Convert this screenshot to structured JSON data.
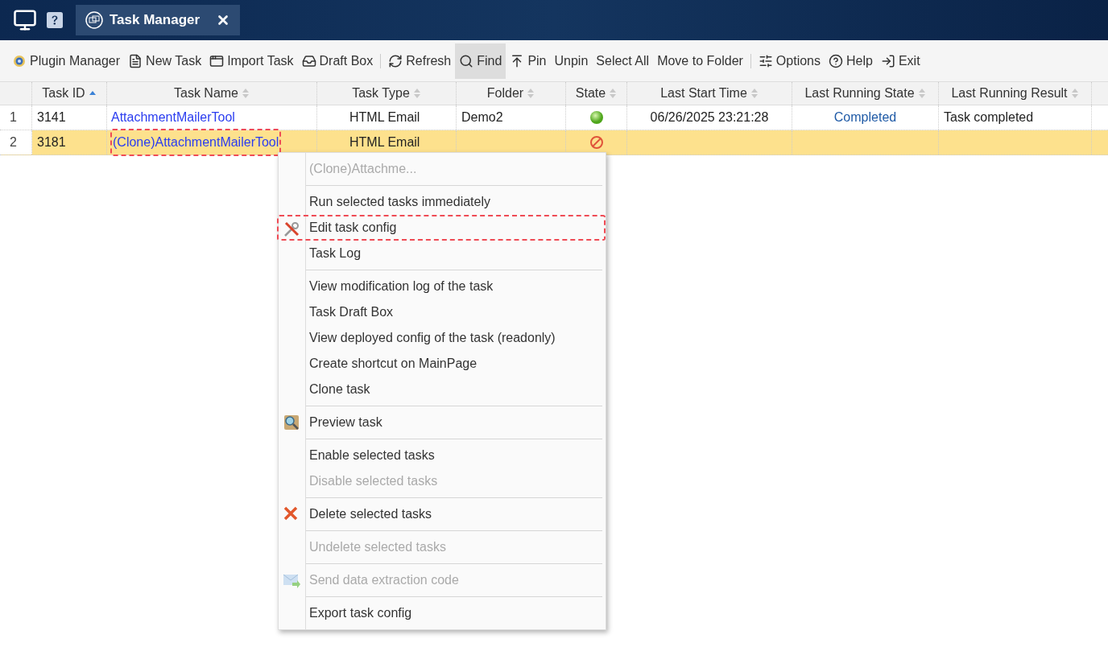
{
  "tab": {
    "title": "Task Manager",
    "selected": true
  },
  "toolbar": [
    {
      "label": "Plugin Manager",
      "kind": "plugin",
      "active": false,
      "separator_after": false
    },
    {
      "label": "New Task",
      "kind": "new",
      "active": false,
      "separator_after": false
    },
    {
      "label": "Import Task",
      "kind": "import",
      "active": false,
      "separator_after": false
    },
    {
      "label": "Draft Box",
      "kind": "draft",
      "active": false,
      "separator_after": true
    },
    {
      "label": "Refresh",
      "kind": "refresh",
      "active": false,
      "separator_after": false
    },
    {
      "label": "Find",
      "kind": "find",
      "active": true,
      "separator_after": false
    },
    {
      "label": "Pin",
      "kind": "pin",
      "active": false,
      "separator_after": false
    },
    {
      "label": "Unpin",
      "kind": "text",
      "active": false,
      "separator_after": false
    },
    {
      "label": "Select All",
      "kind": "text",
      "active": false,
      "separator_after": false
    },
    {
      "label": "Move to Folder",
      "kind": "text",
      "active": false,
      "separator_after": true
    },
    {
      "label": "Options",
      "kind": "options",
      "active": false,
      "separator_after": false
    },
    {
      "label": "Help",
      "kind": "help",
      "active": false,
      "separator_after": false
    },
    {
      "label": "Exit",
      "kind": "exit",
      "active": false,
      "separator_after": false
    }
  ],
  "table": {
    "columns": [
      {
        "label": "Task ID",
        "sorted": true
      },
      {
        "label": "Task Name",
        "sorted": false
      },
      {
        "label": "Task Type",
        "sorted": false
      },
      {
        "label": "Folder",
        "sorted": false
      },
      {
        "label": "State",
        "sorted": false
      },
      {
        "label": "Last Start Time",
        "sorted": false
      },
      {
        "label": "Last Running State",
        "sorted": false
      },
      {
        "label": "Last Running Result",
        "sorted": false
      }
    ],
    "rows": [
      {
        "number": "1",
        "selected": false,
        "task_id": "3141",
        "task_name": "AttachmentMailerTool",
        "name_highlighted": false,
        "task_type": "HTML Email",
        "folder": "Demo2",
        "enabled": true,
        "last_start_time": "06/26/2025 23:21:28",
        "last_running_state": "Completed",
        "last_running_result": "Task completed"
      },
      {
        "number": "2",
        "selected": true,
        "task_id": "3181",
        "task_name": "(Clone)AttachmentMailerTool",
        "name_highlighted": true,
        "task_type": "HTML Email",
        "folder": "",
        "enabled": false,
        "last_start_time": "",
        "last_running_state": "",
        "last_running_result": ""
      }
    ]
  },
  "context_menu": {
    "groups": [
      [
        {
          "label": "(Clone)Attachme...",
          "kind": "text",
          "disabled": true,
          "highlighted": false
        }
      ],
      [
        {
          "label": "Run selected tasks immediately",
          "kind": "text",
          "disabled": false,
          "highlighted": false
        },
        {
          "label": "Edit task config",
          "kind": "edit",
          "disabled": false,
          "highlighted": true
        },
        {
          "label": "Task Log",
          "kind": "text",
          "disabled": false,
          "highlighted": false
        }
      ],
      [
        {
          "label": "View modification log of the task",
          "kind": "text",
          "disabled": false,
          "highlighted": false
        },
        {
          "label": "Task Draft Box",
          "kind": "text",
          "disabled": false,
          "highlighted": false
        },
        {
          "label": "View deployed config of the task (readonly)",
          "kind": "text",
          "disabled": false,
          "highlighted": false
        },
        {
          "label": "Create shortcut on MainPage",
          "kind": "text",
          "disabled": false,
          "highlighted": false
        },
        {
          "label": "Clone task",
          "kind": "text",
          "disabled": false,
          "highlighted": false
        }
      ],
      [
        {
          "label": "Preview task",
          "kind": "preview",
          "disabled": false,
          "highlighted": false
        }
      ],
      [
        {
          "label": "Enable selected tasks",
          "kind": "text",
          "disabled": false,
          "highlighted": false
        },
        {
          "label": "Disable selected tasks",
          "kind": "text",
          "disabled": true,
          "highlighted": false
        }
      ],
      [
        {
          "label": "Delete selected tasks",
          "kind": "delete",
          "disabled": false,
          "highlighted": false
        }
      ],
      [
        {
          "label": "Undelete selected tasks",
          "kind": "text",
          "disabled": true,
          "highlighted": false
        }
      ],
      [
        {
          "label": "Send data extraction code",
          "kind": "send",
          "disabled": true,
          "highlighted": false
        }
      ],
      [
        {
          "label": "Export task config",
          "kind": "text",
          "disabled": false,
          "highlighted": false
        }
      ]
    ]
  }
}
